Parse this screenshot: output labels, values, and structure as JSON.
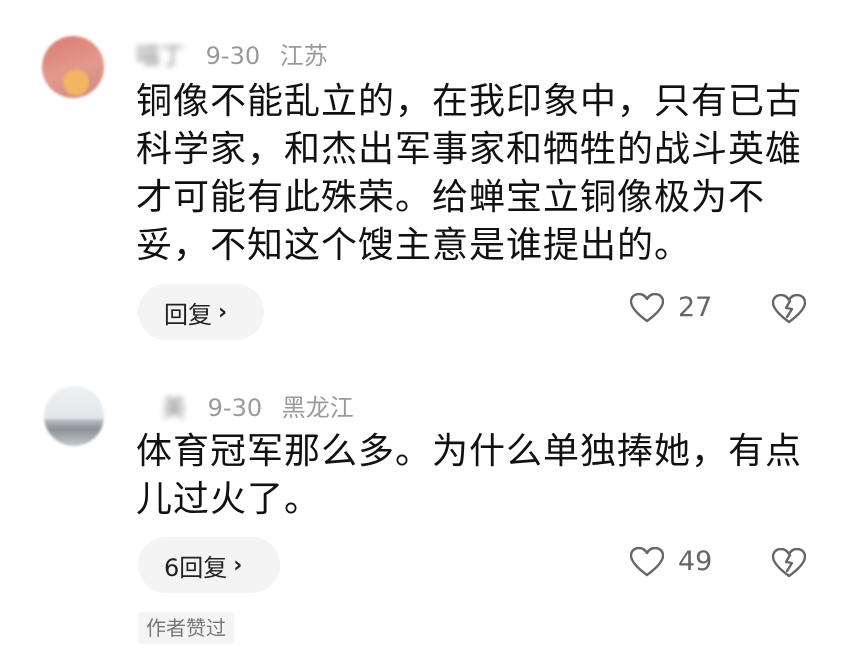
{
  "comments": [
    {
      "author": "喵丁",
      "date": "9-30",
      "location": "江苏",
      "text": "铜像不能乱立的，在我印象中，只有已古科学家，和杰出军事家和牺牲的战斗英雄才可能有此殊荣。给蝉宝立铜像极为不妥，不知这个馊主意是谁提出的。",
      "reply_label": "回复",
      "likes": "27",
      "icons": {
        "like": "heart-icon",
        "dislike": "broken-heart-icon",
        "reply": "chevron-right-icon"
      }
    },
    {
      "author": "美",
      "date": "9-30",
      "location": "黑龙江",
      "text": "体育冠军那么多。为什么单独捧她，有点儿过火了。",
      "reply_label": "6回复",
      "likes": "49",
      "author_liked": "作者赞过",
      "icons": {
        "like": "heart-icon",
        "dislike": "broken-heart-icon",
        "reply": "chevron-right-icon"
      }
    }
  ],
  "colors": {
    "text": "#111111",
    "meta": "#9a9a9a",
    "pill_bg": "#f4f4f4",
    "icon": "#666666"
  }
}
